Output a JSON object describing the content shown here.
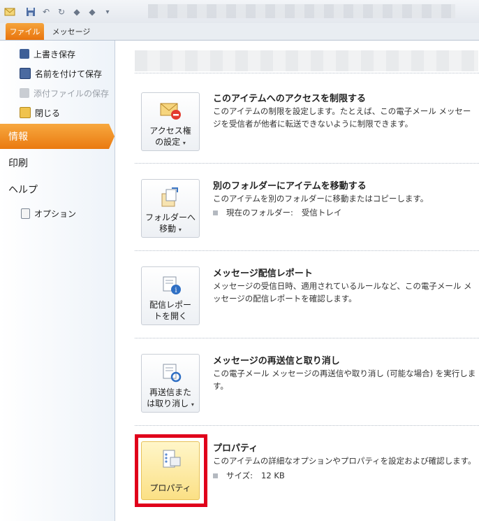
{
  "quick_access": {
    "icons": [
      "mail-app-icon",
      "save-icon",
      "undo-icon",
      "redo-icon",
      "up-arrow-icon",
      "down-arrow-icon",
      "customize-icon"
    ]
  },
  "ribbon": {
    "tabs": [
      "ファイル",
      "メッセージ"
    ]
  },
  "sidebar": {
    "commands": [
      "上書き保存",
      "名前を付けて保存",
      "添付ファイルの保存",
      "閉じる"
    ],
    "tabs": [
      "情報",
      "印刷",
      "ヘルプ"
    ],
    "options_label": "オプション"
  },
  "sections": [
    {
      "button_label_1": "アクセス権",
      "button_label_2": "の設定",
      "title": "このアイテムへのアクセスを制限する",
      "desc": "このアイテムの制限を設定します。たとえば、この電子メール メッセージを受信者が他者に転送できないように制限できます。"
    },
    {
      "button_label_1": "フォルダーへ",
      "button_label_2": "移動",
      "title": "別のフォルダーにアイテムを移動する",
      "desc": "このアイテムを別のフォルダーに移動またはコピーします。",
      "bullet_label": "現在のフォルダー:",
      "bullet_value": "受信トレイ"
    },
    {
      "button_label_1": "配信レポー",
      "button_label_2": "トを開く",
      "title": "メッセージ配信レポート",
      "desc": "メッセージの受信日時、適用されているルールなど、この電子メール メッセージの配信レポートを確認します。"
    },
    {
      "button_label_1": "再送信また",
      "button_label_2": "は取り消し",
      "title": "メッセージの再送信と取り消し",
      "desc": "この電子メール メッセージの再送信や取り消し (可能な場合) を実行します。"
    },
    {
      "button_label_1": "プロパティ",
      "title": "プロパティ",
      "desc": "このアイテムの詳細なオプションやプロパティを設定および確認します。",
      "bullet_label": "サイズ:",
      "bullet_value": "12 KB"
    }
  ],
  "colors": {
    "accent_orange": "#ea7a10",
    "highlight_red": "#e0001b"
  }
}
